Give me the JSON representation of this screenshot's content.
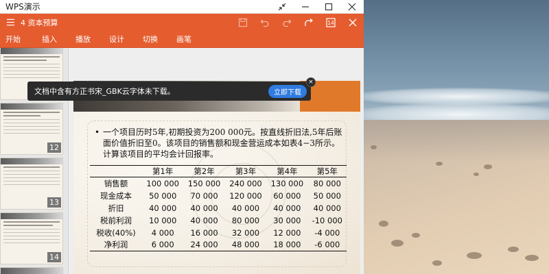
{
  "window": {
    "app_title": "WPS演示"
  },
  "appbar": {
    "doc_title": "4 资本预算",
    "page_badge": "14"
  },
  "ribbon": {
    "tabs": [
      "开始",
      "插入",
      "播放",
      "设计",
      "切换",
      "画笔"
    ]
  },
  "thumbnails": [
    {
      "number": ""
    },
    {
      "number": "12"
    },
    {
      "number": "13"
    },
    {
      "number": "14"
    }
  ],
  "toast": {
    "message": "文档中含有方正书宋_GBK云字体未下载。",
    "action": "立即下载",
    "close": "×"
  },
  "slide": {
    "bullet": "•",
    "text": "一个项目历时5年,初期投资为200 000元。按直线折旧法,5年后账面价值折旧至0。该项目的销售额和现金营运成本如表4−3所示。计算该项目的平均会计回报率。",
    "table": {
      "headers": [
        "",
        "第1年",
        "第2年",
        "第3年",
        "第4年",
        "第5年"
      ],
      "rows": [
        {
          "label": "销售额",
          "values": [
            "100 000",
            "150 000",
            "240 000",
            "130 000",
            "80 000"
          ]
        },
        {
          "label": "现金成本",
          "values": [
            "50 000",
            "70 000",
            "120 000",
            "60 000",
            "50 000"
          ]
        },
        {
          "label": "折旧",
          "values": [
            "40 000",
            "40 000",
            "40 000",
            "40 000",
            "40 000"
          ]
        },
        {
          "label": "税前利润",
          "values": [
            "10 000",
            "40 000",
            "80 000",
            "30 000",
            "-10 000"
          ]
        },
        {
          "label": "税收(40%)",
          "values": [
            "4 000",
            "16 000",
            "32 000",
            "12 000",
            "-4 000"
          ]
        },
        {
          "label": "净利润",
          "values": [
            "6 000",
            "24 000",
            "48 000",
            "18 000",
            "-6 000"
          ]
        }
      ]
    }
  },
  "colors": {
    "accent": "#e55c2f",
    "toast_bg": "#2b2b2b",
    "toast_button": "#2f7be0",
    "slide_header_orange": "#e07a2a"
  }
}
